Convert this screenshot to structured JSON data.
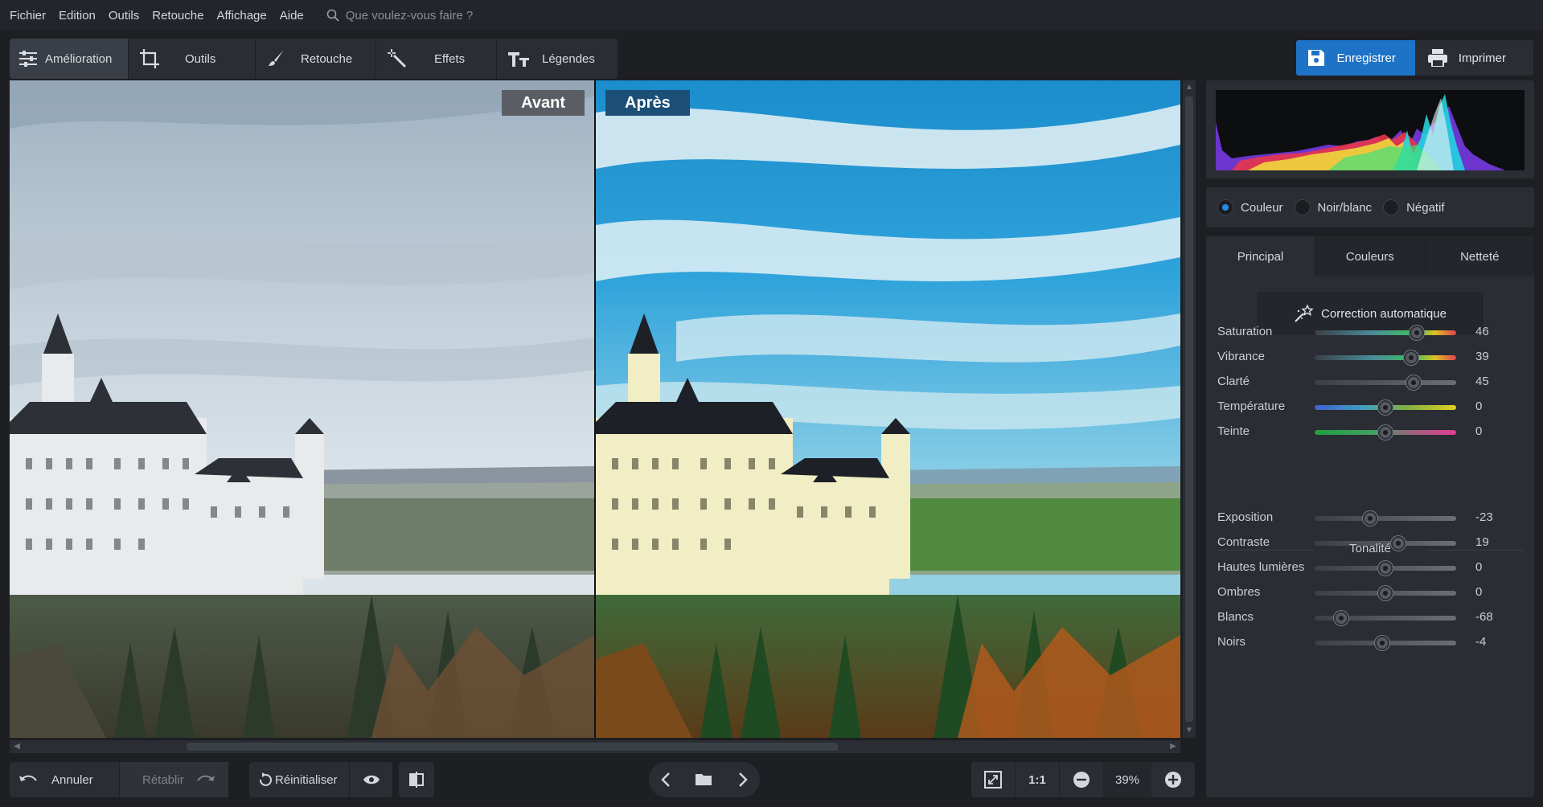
{
  "menu": {
    "items": [
      "Fichier",
      "Edition",
      "Outils",
      "Retouche",
      "Affichage",
      "Aide"
    ],
    "search_placeholder": "Que voulez-vous faire ?"
  },
  "toolbar": {
    "tabs": [
      {
        "label": "Amélioration",
        "icon": "sliders-icon",
        "active": true
      },
      {
        "label": "Outils",
        "icon": "crop-icon"
      },
      {
        "label": "Retouche",
        "icon": "brush-icon"
      },
      {
        "label": "Effets",
        "icon": "magic-wand-icon"
      },
      {
        "label": "Légendes",
        "icon": "text-icon"
      }
    ],
    "save_label": "Enregistrer",
    "print_label": "Imprimer"
  },
  "view": {
    "before_label": "Avant",
    "after_label": "Après"
  },
  "bottom": {
    "undo_label": "Annuler",
    "redo_label": "Rétablir",
    "reset_label": "Réinitialiser",
    "zoom_1to1": "1:1",
    "zoom_value": "39%"
  },
  "panel": {
    "color_modes": [
      {
        "label": "Couleur",
        "checked": true
      },
      {
        "label": "Noir/blanc",
        "checked": false
      },
      {
        "label": "Négatif",
        "checked": false
      }
    ],
    "tabs": [
      {
        "label": "Principal",
        "active": true
      },
      {
        "label": "Couleurs"
      },
      {
        "label": "Netteté"
      }
    ],
    "auto_correct_label": "Correction automatique",
    "sliders": [
      {
        "label": "Saturation",
        "value": "46",
        "position": 0.72,
        "track": "saturation"
      },
      {
        "label": "Vibrance",
        "value": "39",
        "position": 0.68,
        "track": "saturation"
      },
      {
        "label": "Clarté",
        "value": "45",
        "position": 0.7,
        "track": "gray"
      },
      {
        "label": "Température",
        "value": "0",
        "position": 0.5,
        "track": "temperature"
      },
      {
        "label": "Teinte",
        "value": "0",
        "position": 0.5,
        "track": "tint"
      }
    ],
    "tonalite_title": "Tonalité",
    "tone_sliders": [
      {
        "label": "Exposition",
        "value": "-23",
        "position": 0.39
      },
      {
        "label": "Contraste",
        "value": "19",
        "position": 0.59
      },
      {
        "label": "Hautes lumières",
        "value": "0",
        "position": 0.5
      },
      {
        "label": "Ombres",
        "value": "0",
        "position": 0.5
      },
      {
        "label": "Blancs",
        "value": "-68",
        "position": 0.19
      },
      {
        "label": "Noirs",
        "value": "-4",
        "position": 0.48
      }
    ]
  },
  "colors": {
    "accent": "#1e73c7",
    "panel": "#2a2d33",
    "background": "#1d1f23"
  }
}
